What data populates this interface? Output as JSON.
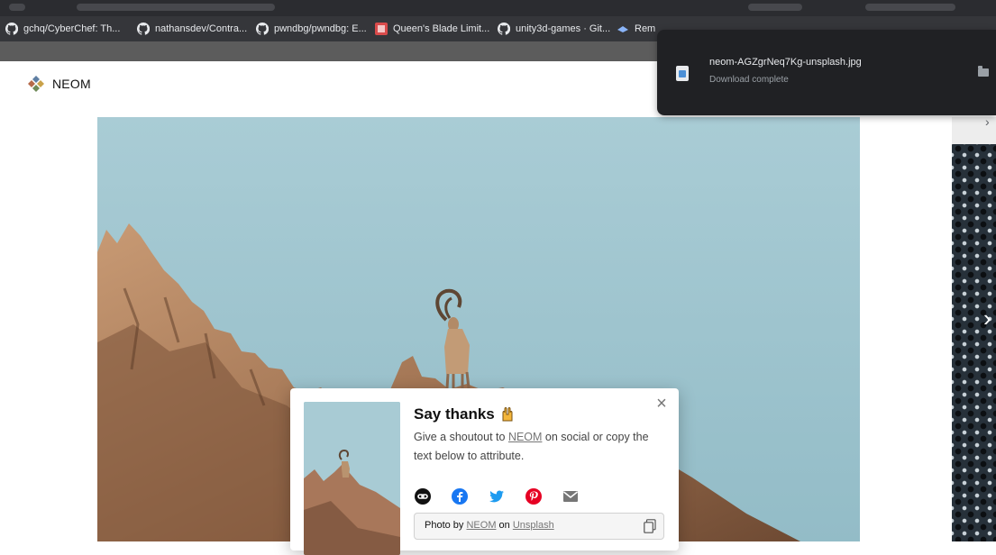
{
  "browser": {
    "bookmarks": [
      {
        "label": "gchq/CyberChef: Th...",
        "icon": "github-icon"
      },
      {
        "label": "nathansdev/Contra...",
        "icon": "github-icon"
      },
      {
        "label": "pwndbg/pwndbg: E...",
        "icon": "github-icon"
      },
      {
        "label": "Queen's Blade Limit...",
        "icon": "bookmark-favicon-icon"
      },
      {
        "label": "unity3d-games · Git...",
        "icon": "github-icon"
      },
      {
        "label": "Rem",
        "icon": "bookmark-favicon-icon"
      }
    ],
    "load_progress": 0.72
  },
  "download": {
    "filename": "neom-AGZgrNeq7Kg-unsplash.jpg",
    "status": "Download complete",
    "file_icon": "image-file-icon",
    "folder_icon": "folder-icon"
  },
  "page": {
    "brand_name": "NEOM"
  },
  "modal": {
    "title": "Say thanks",
    "emoji": "raising-hands-icon",
    "body_prefix": "Give a shoutout to ",
    "body_link": "NEOM",
    "body_suffix": " on social or copy the text below to attribute.",
    "share_icons": [
      "link-icon",
      "facebook-icon",
      "twitter-icon",
      "pinterest-icon",
      "email-icon"
    ],
    "attribution_prefix": "Photo by ",
    "attribution_author": "NEOM",
    "attribution_mid": " on ",
    "attribution_site": "Unsplash",
    "close_symbol": "×"
  },
  "colors": {
    "sky": "#9fc5cf",
    "rock": "#b98a63",
    "chrome_dark": "#35363a",
    "download_bg": "#202124"
  }
}
